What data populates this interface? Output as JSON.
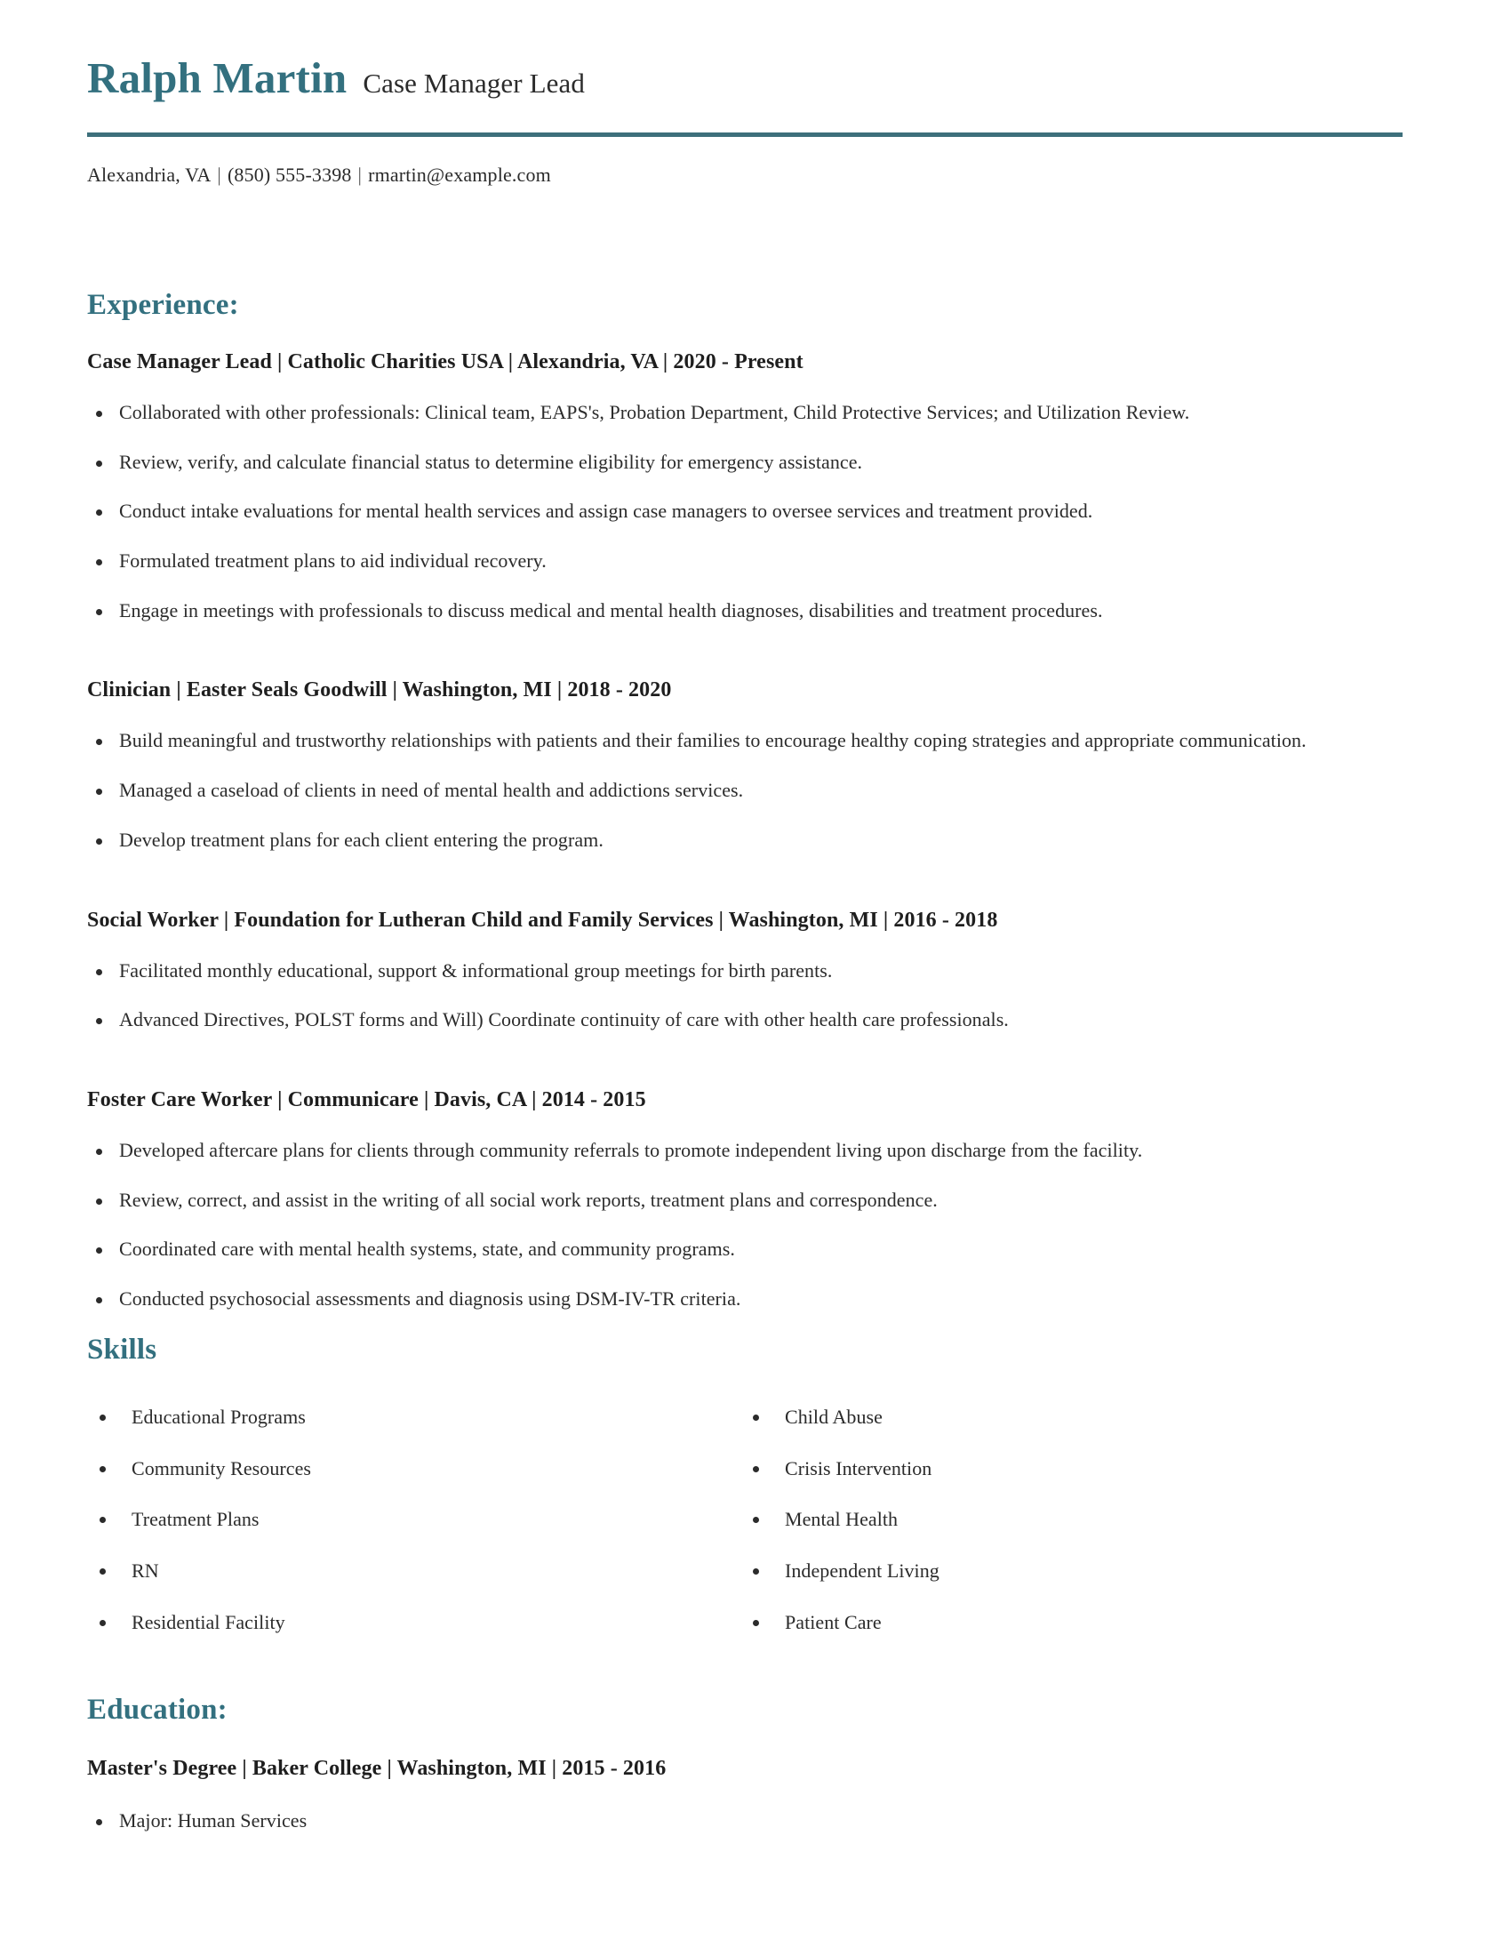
{
  "header": {
    "full_name": "Ralph Martin",
    "job_title": "Case Manager Lead",
    "separator": "|",
    "contact": {
      "location": "Alexandria, VA",
      "phone": "(850) 555-3398",
      "email": "rmartin@example.com"
    }
  },
  "theme": {
    "accent_color": "#33707f",
    "rule_color": "#3d6f7b",
    "text_color": "#2b2b2b"
  },
  "experience": {
    "title": "Experience:",
    "jobs": [
      {
        "heading": "Case Manager Lead | Catholic Charities USA | Alexandria, VA | 2020 - Present",
        "bullets": [
          "Collaborated with other professionals: Clinical team, EAPS's, Probation Department, Child Protective Services; and Utilization Review.",
          "Review, verify, and calculate financial status to determine eligibility for emergency assistance.",
          "Conduct intake evaluations for mental health services and assign case managers to oversee services and treatment provided.",
          "Formulated treatment plans to aid individual recovery.",
          "Engage in meetings with professionals to discuss medical and mental health diagnoses, disabilities and treatment procedures."
        ]
      },
      {
        "heading": "Clinician | Easter Seals Goodwill | Washington, MI | 2018 - 2020",
        "bullets": [
          "Build meaningful and trustworthy relationships with patients and their families to encourage healthy coping strategies and appropriate communication.",
          "Managed a caseload of clients in need of mental health and addictions services.",
          "Develop treatment plans for each client entering the program."
        ]
      },
      {
        "heading": "Social Worker | Foundation for Lutheran Child and Family Services | Washington, MI | 2016 - 2018",
        "bullets": [
          "Facilitated monthly educational, support & informational group meetings for birth parents.",
          "Advanced Directives, POLST forms and Will) Coordinate continuity of care with other health care professionals."
        ]
      },
      {
        "heading": "Foster Care Worker | Communicare | Davis, CA | 2014 - 2015",
        "bullets": [
          "Developed aftercare plans for clients through community referrals to promote independent living upon discharge from the facility.",
          "Review, correct, and assist in the writing of all social work reports, treatment plans and correspondence.",
          "Coordinated care with mental health systems, state, and community programs.",
          "Conducted psychosocial assessments and diagnosis using DSM-IV-TR criteria."
        ]
      }
    ]
  },
  "skills": {
    "title": "Skills",
    "column_left": [
      "Educational Programs",
      "Community Resources",
      "Treatment Plans",
      "RN",
      "Residential Facility"
    ],
    "column_right": [
      "Child Abuse",
      "Crisis Intervention",
      "Mental Health",
      "Independent Living",
      "Patient Care"
    ]
  },
  "education": {
    "title": "Education:",
    "entries": [
      {
        "heading": "Master's Degree | Baker College | Washington, MI | 2015 - 2016",
        "bullets": [
          "Major: Human Services"
        ]
      }
    ]
  }
}
